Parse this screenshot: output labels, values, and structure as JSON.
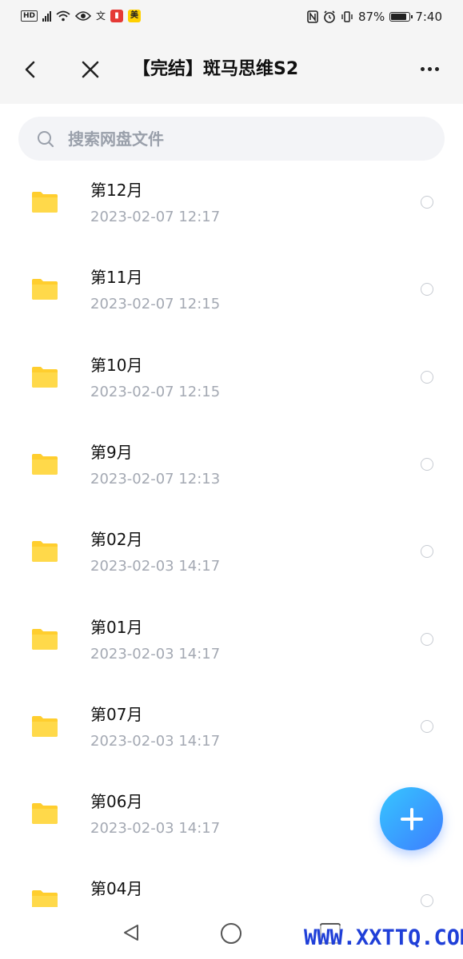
{
  "status_bar": {
    "left_icons": [
      "hd-icon",
      "signal-4g-icon",
      "wifi-icon",
      "eye-icon",
      "translate-icon",
      "red-app-icon",
      "yellow-app-icon"
    ],
    "translate_glyph": "文",
    "yellow_app_glyph": "美",
    "battery_percent": "87%",
    "battery_level": 0.87,
    "time": "7:40"
  },
  "header": {
    "title": "【完结】斑马思维S2"
  },
  "search": {
    "placeholder": "搜索网盘文件"
  },
  "files": [
    {
      "name": "第12月",
      "date": "2023-02-07  12:17"
    },
    {
      "name": "第11月",
      "date": "2023-02-07  12:15"
    },
    {
      "name": "第10月",
      "date": "2023-02-07  12:15"
    },
    {
      "name": "第9月",
      "date": "2023-02-07  12:13"
    },
    {
      "name": "第02月",
      "date": "2023-02-03  14:17"
    },
    {
      "name": "第01月",
      "date": "2023-02-03  14:17"
    },
    {
      "name": "第07月",
      "date": "2023-02-03  14:17"
    },
    {
      "name": "第06月",
      "date": "2023-02-03  14:17"
    },
    {
      "name": "第04月",
      "date": ""
    }
  ],
  "colors": {
    "folder": "#ffd43b",
    "fab_start": "#36c6ff",
    "fab_end": "#3d7dff",
    "date_text": "#a4a9b3",
    "watermark": "#1f3fd8"
  },
  "watermark": "WWW.XXTTQ.COM"
}
